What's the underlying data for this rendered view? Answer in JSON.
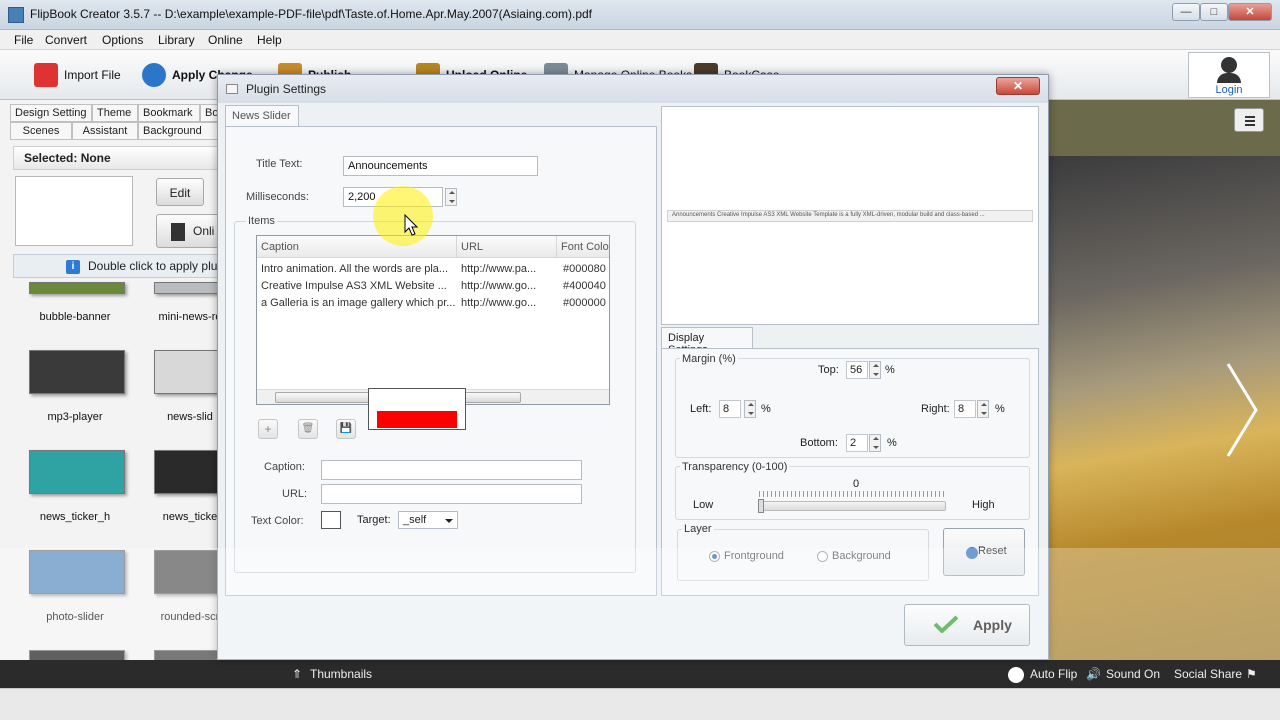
{
  "window": {
    "title": "FlipBook Creator 3.5.7  -- D:\\example\\example-PDF-file\\pdf\\Taste.of.Home.Apr.May.2007(Asiaing.com).pdf",
    "min": "—",
    "max": "□",
    "close": "✕"
  },
  "menu": [
    "File",
    "Convert",
    "Options",
    "Library",
    "Online",
    "Help"
  ],
  "toolbar": {
    "import_file": "Import File",
    "apply_change": "Apply Change",
    "publish": "Publish",
    "upload_online": "Upload Online",
    "manage_online_books": "Manage Online Books",
    "bookcase": "BookCase",
    "login": "Login"
  },
  "left": {
    "tabs_row1": [
      "Design Setting",
      "Theme",
      "Bookmark",
      "Bo"
    ],
    "tabs_row2": [
      "Scenes",
      "Assistant",
      "Background"
    ],
    "selected": "Selected: None",
    "edit_button": "Edit",
    "online_button": "Onli",
    "hint": "Double click to apply plugin",
    "plugins": [
      {
        "name": "bubble-banner",
        "color": "#6a8a3a"
      },
      {
        "name": "mini-news-ro",
        "color": "#b9bcc0"
      },
      {
        "name": "mp3-player",
        "color": "#3a3a3a"
      },
      {
        "name": "news-slid",
        "color": "#d8d8d8"
      },
      {
        "name": "news_ticker_h",
        "color": "#2fa3a3"
      },
      {
        "name": "news_ticke",
        "color": "#2a2a2a"
      },
      {
        "name": "photo-slider",
        "color": "#5e8fbf"
      },
      {
        "name": "rounded-scr",
        "color": "#5a5a5a"
      }
    ]
  },
  "bottom": {
    "thumbnails": "Thumbnails",
    "auto_flip": "Auto Flip",
    "sound_on": "Sound On",
    "social_share": "Social Share"
  },
  "dialog": {
    "title": "Plugin Settings",
    "close": "✕",
    "tab": "News Slider",
    "title_text_label": "Title Text:",
    "title_text_value": "Announcements",
    "ms_label": "Milliseconds:",
    "ms_value": "2,200",
    "items_label": "Items",
    "columns": [
      "Caption",
      "URL",
      "Font Colo"
    ],
    "rows": [
      [
        "Intro animation. All the words are pla...",
        "http://www.pa...",
        "#000080"
      ],
      [
        "Creative Impulse  AS3 XML  Website ...",
        "http://www.go...",
        "#400040"
      ],
      [
        "a Galleria is an image gallery which pr...",
        "http://www.go...",
        "#000000"
      ]
    ],
    "add_icon": "+",
    "delete_icon": "🗑",
    "save_icon": "💾",
    "caption_label": "Caption:",
    "url_label": "URL:",
    "text_color_label": "Text Color:",
    "target_label": "Target:",
    "target_value": "_self",
    "preview_ticker": "Announcements    Creative Impulse  AS3 XML  Website Template  is a fully  XML-driven, modular build  and class-based ...",
    "display_tab": "Display Settings",
    "margin_label": "Margin (%)",
    "top_label": "Top:",
    "top_value": "56",
    "left_label": "Left:",
    "left_value": "8",
    "right_label": "Right:",
    "right_value": "8",
    "bottom_label": "Bottom:",
    "bottom_value": "2",
    "pct": "%",
    "transparency_label": "Transparency (0-100)",
    "transparency_value": "0",
    "low": "Low",
    "high": "High",
    "layer_label": "Layer",
    "frontground": "Frontground",
    "background": "Background",
    "reset": "Reset",
    "apply": "Apply"
  }
}
